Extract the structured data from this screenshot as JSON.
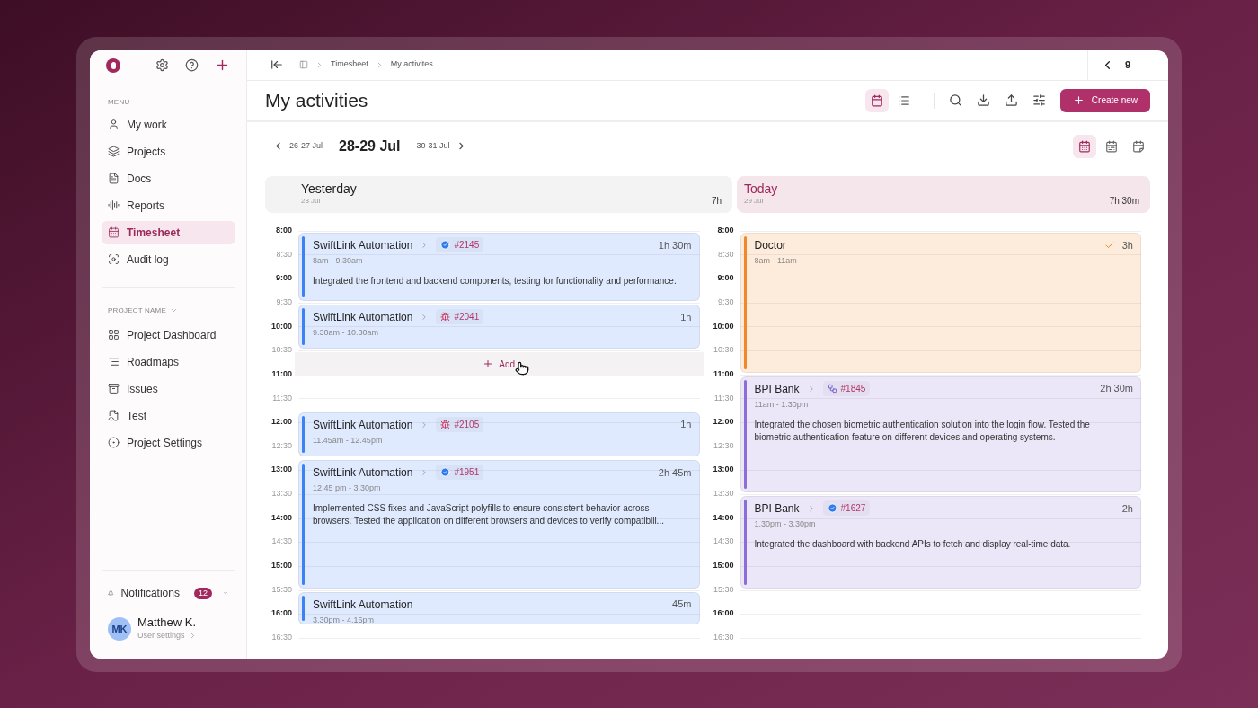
{
  "sidebar": {
    "menu_label": "MENU",
    "menu_items": [
      {
        "label": "My work",
        "selected": false
      },
      {
        "label": "Projects",
        "selected": false
      },
      {
        "label": "Docs",
        "selected": false
      },
      {
        "label": "Reports",
        "selected": false
      },
      {
        "label": "Timesheet",
        "selected": true
      },
      {
        "label": "Audit log",
        "selected": false
      }
    ],
    "project_label": "PROJECT NAME",
    "project_items": [
      {
        "label": "Project Dashboard",
        "selected": false
      },
      {
        "label": "Roadmaps",
        "selected": false
      },
      {
        "label": "Issues",
        "selected": false
      },
      {
        "label": "Test",
        "selected": false
      },
      {
        "label": "Project Settings",
        "selected": false
      }
    ],
    "notifications": {
      "label": "Notifications",
      "count": "12"
    },
    "user": {
      "initials": "MK",
      "name": "Matthew K.",
      "link": "User settings"
    }
  },
  "breadcrumbs": [
    "Timesheet",
    "My activites"
  ],
  "pager": {
    "count": "9"
  },
  "title": "My activities",
  "views": [
    {
      "selected": true
    },
    {
      "selected": false
    }
  ],
  "create_button": "Create new",
  "date_nav": {
    "previous": "26-27 Jul",
    "current": "28-29 Jul",
    "next": "30-31 Jul"
  },
  "range_views": [
    {
      "selected": true
    },
    {
      "selected": false
    },
    {
      "selected": false
    }
  ],
  "days": [
    {
      "title": "Yesterday",
      "date": "28 Jul",
      "total": "7h",
      "today": false,
      "times": [
        "8:00",
        "8:30",
        "9:00",
        "9:30",
        "10:00",
        "10:30",
        "11:00",
        "11:30",
        "12:00",
        "12:30",
        "13:00",
        "13:30",
        "14:00",
        "14:30",
        "15:00",
        "15:30",
        "16:00",
        "16:30"
      ],
      "add_label": "Add",
      "events": [
        {
          "title": "SwiftLink Automation",
          "tag": {
            "kind": "task",
            "label": "#2145"
          },
          "time": "8am - 9.30am",
          "duration": "1h 30m",
          "checked": false,
          "color": "#3b82f6",
          "description": "Integrated the frontend and backend components, testing for functionality and performance."
        },
        {
          "title": "SwiftLink Automation",
          "tag": {
            "kind": "bug",
            "label": "#2041"
          },
          "time": "9.30am - 10.30am",
          "duration": "1h",
          "checked": false,
          "color": "#3b82f6"
        },
        {
          "title": "SwiftLink Automation",
          "tag": {
            "kind": "bug",
            "label": "#2105"
          },
          "time": "11.45am - 12.45pm",
          "duration": "1h",
          "checked": false,
          "color": "#3b82f6"
        },
        {
          "title": "SwiftLink Automation",
          "tag": {
            "kind": "task",
            "label": "#1951"
          },
          "time": "12.45 pm - 3.30pm",
          "duration": "2h 45m",
          "checked": false,
          "color": "#3b82f6",
          "description": "Implemented CSS fixes and JavaScript polyfills to ensure consistent behavior across browsers. Tested the application on different browsers and devices to verify compatibili..."
        },
        {
          "title": "SwiftLink Automation",
          "time": "3.30pm - 4.15pm",
          "duration": "45m",
          "checked": false,
          "color": "#3b82f6"
        }
      ]
    },
    {
      "title": "Today",
      "date": "29 Jul",
      "total": "7h 30m",
      "today": true,
      "times": [
        "8:00",
        "8:30",
        "9:00",
        "9:30",
        "10:00",
        "10:30",
        "11:00",
        "11:30",
        "12:00",
        "12:30",
        "13:00",
        "13:30",
        "14:00",
        "14:30",
        "15:00",
        "15:30",
        "16:00",
        "16:30"
      ],
      "events": [
        {
          "title": "Doctor",
          "time": "8am - 11am",
          "duration": "3h",
          "checked": true,
          "color": "#f0892b"
        },
        {
          "title": "BPI Bank",
          "tag": {
            "kind": "integration",
            "label": "#1845"
          },
          "time": "11am - 1.30pm",
          "duration": "2h 30m",
          "checked": false,
          "color": "#8b6fd6",
          "description": "Integrated the chosen biometric authentication solution into the login flow. Tested the biometric authentication feature on different devices and operating systems."
        },
        {
          "title": "BPI Bank",
          "tag": {
            "kind": "task",
            "label": "#1627"
          },
          "time": "1.30pm - 3.30pm",
          "duration": "2h",
          "checked": false,
          "color": "#8b6fd6",
          "description": "Integrated the dashboard with backend APIs to fetch and display real-time data."
        }
      ]
    }
  ]
}
